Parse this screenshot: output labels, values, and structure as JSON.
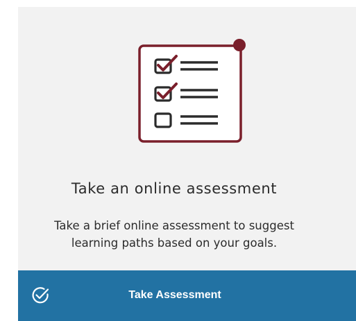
{
  "card": {
    "title": "Take an online assessment",
    "description_line1": "Take a brief online assessment to suggest",
    "description_line2": "learning paths based on your goals.",
    "illustration_icon": "checklist-icon",
    "action": {
      "label": "Take Assessment",
      "icon": "check-circle-icon"
    }
  },
  "colors": {
    "card_background": "#f2f2f2",
    "accent": "#7a1f2b",
    "action_bar": "#2272a3",
    "action_text": "#ffffff",
    "text": "#2b2b2b"
  }
}
